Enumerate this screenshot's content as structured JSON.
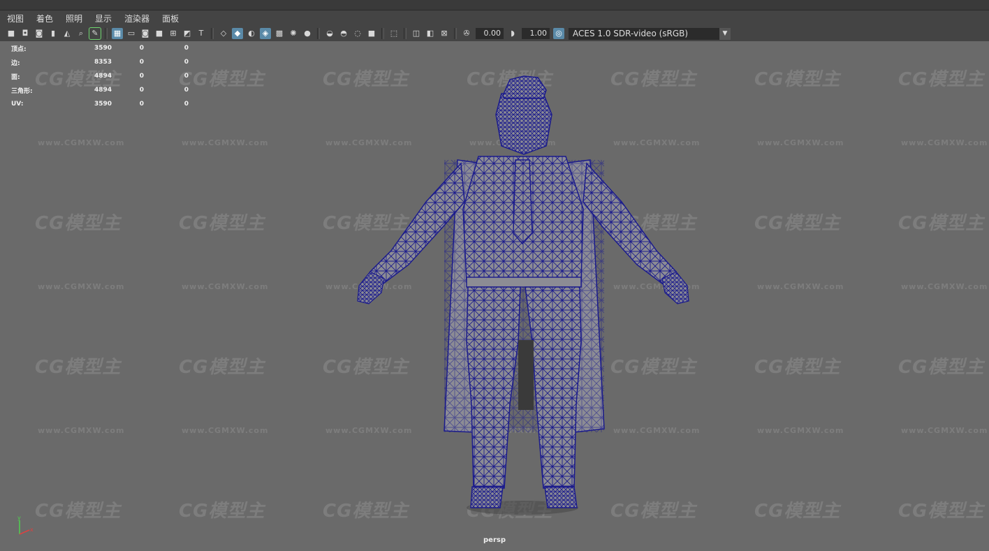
{
  "menu": [
    "视图",
    "着色",
    "照明",
    "显示",
    "渲染器",
    "面板"
  ],
  "toolbar": {
    "icons": [
      "camera-icon",
      "camera-lock-icon",
      "camera-attr-icon",
      "bookmark-icon",
      "image-plane-icon",
      "snapshot-icon",
      "grease-pencil-icon",
      "grid-icon",
      "film-gate-icon",
      "resolution-gate-icon",
      "gate-mask-icon",
      "field-chart-icon",
      "safe-action-icon",
      "safe-title-icon",
      "wireframe-icon",
      "smooth-shade-icon",
      "default-material-icon",
      "wireframe-on-shaded-icon",
      "textured-icon",
      "use-lights-icon",
      "shadows-icon",
      "screen-ambient-occlusion-icon",
      "motion-blur-icon",
      "multisample-aa-icon",
      "depth-of-field-icon",
      "isolate-select-icon",
      "xray-icon",
      "xray-joints-icon",
      "backface-icon",
      "exposure-icon",
      "gamma-icon",
      "color-management-icon"
    ],
    "exposure": "0.00",
    "gamma": "1.00",
    "colorspace": "ACES 1.0 SDR-video (sRGB)"
  },
  "hud": {
    "rows": [
      {
        "label": "顶点:",
        "v1": "3590",
        "v2": "0",
        "v3": "0"
      },
      {
        "label": "边:",
        "v1": "8353",
        "v2": "0",
        "v3": "0"
      },
      {
        "label": "面:",
        "v1": "4894",
        "v2": "0",
        "v3": "0"
      },
      {
        "label": "三角形:",
        "v1": "4894",
        "v2": "0",
        "v3": "0"
      },
      {
        "label": "UV:",
        "v1": "3590",
        "v2": "0",
        "v3": "0"
      }
    ]
  },
  "watermark": {
    "logo": "CG模型主",
    "url": "www.CGMXW.com"
  },
  "camera_label": "persp",
  "axis": {
    "x": "x",
    "y": "y"
  },
  "colors": {
    "wire": "#1b1b8c",
    "mesh": "#8c8c94",
    "viewport": "#6a6a6a",
    "accent": "#5a8aa8"
  }
}
